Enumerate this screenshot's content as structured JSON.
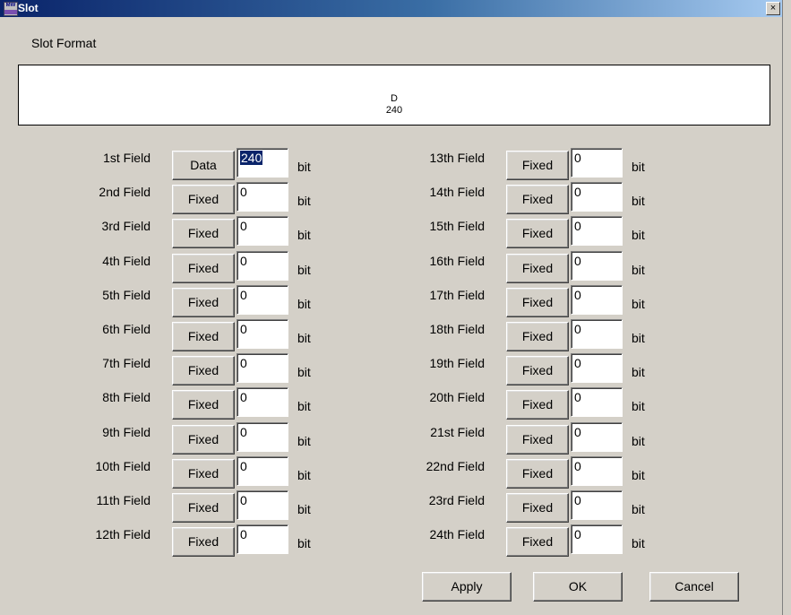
{
  "window": {
    "title": "Slot",
    "close_symbol": "×",
    "app_icon": "app-icon"
  },
  "slot_format": {
    "label": "Slot Format",
    "segment_name": "D",
    "segment_length": "240"
  },
  "fields": [
    {
      "label": "1st Field",
      "type": "Data",
      "value": "240",
      "unit": "bit",
      "selected": true
    },
    {
      "label": "2nd Field",
      "type": "Fixed",
      "value": "0",
      "unit": "bit"
    },
    {
      "label": "3rd Field",
      "type": "Fixed",
      "value": "0",
      "unit": "bit"
    },
    {
      "label": "4th Field",
      "type": "Fixed",
      "value": "0",
      "unit": "bit"
    },
    {
      "label": "5th Field",
      "type": "Fixed",
      "value": "0",
      "unit": "bit"
    },
    {
      "label": "6th Field",
      "type": "Fixed",
      "value": "0",
      "unit": "bit"
    },
    {
      "label": "7th Field",
      "type": "Fixed",
      "value": "0",
      "unit": "bit"
    },
    {
      "label": "8th Field",
      "type": "Fixed",
      "value": "0",
      "unit": "bit"
    },
    {
      "label": "9th Field",
      "type": "Fixed",
      "value": "0",
      "unit": "bit"
    },
    {
      "label": "10th Field",
      "type": "Fixed",
      "value": "0",
      "unit": "bit"
    },
    {
      "label": "11th Field",
      "type": "Fixed",
      "value": "0",
      "unit": "bit"
    },
    {
      "label": "12th Field",
      "type": "Fixed",
      "value": "0",
      "unit": "bit"
    },
    {
      "label": "13th Field",
      "type": "Fixed",
      "value": "0",
      "unit": "bit"
    },
    {
      "label": "14th Field",
      "type": "Fixed",
      "value": "0",
      "unit": "bit"
    },
    {
      "label": "15th Field",
      "type": "Fixed",
      "value": "0",
      "unit": "bit"
    },
    {
      "label": "16th Field",
      "type": "Fixed",
      "value": "0",
      "unit": "bit"
    },
    {
      "label": "17th Field",
      "type": "Fixed",
      "value": "0",
      "unit": "bit"
    },
    {
      "label": "18th Field",
      "type": "Fixed",
      "value": "0",
      "unit": "bit"
    },
    {
      "label": "19th Field",
      "type": "Fixed",
      "value": "0",
      "unit": "bit"
    },
    {
      "label": "20th Field",
      "type": "Fixed",
      "value": "0",
      "unit": "bit"
    },
    {
      "label": "21st Field",
      "type": "Fixed",
      "value": "0",
      "unit": "bit"
    },
    {
      "label": "22nd Field",
      "type": "Fixed",
      "value": "0",
      "unit": "bit"
    },
    {
      "label": "23rd Field",
      "type": "Fixed",
      "value": "0",
      "unit": "bit"
    },
    {
      "label": "24th Field",
      "type": "Fixed",
      "value": "0",
      "unit": "bit"
    }
  ],
  "buttons": {
    "apply": "Apply",
    "ok": "OK",
    "cancel": "Cancel"
  },
  "colors": {
    "titlebar_start": "#0a246a",
    "titlebar_end": "#a6caf0",
    "face": "#d4d0c8",
    "selection": "#0a246a"
  }
}
